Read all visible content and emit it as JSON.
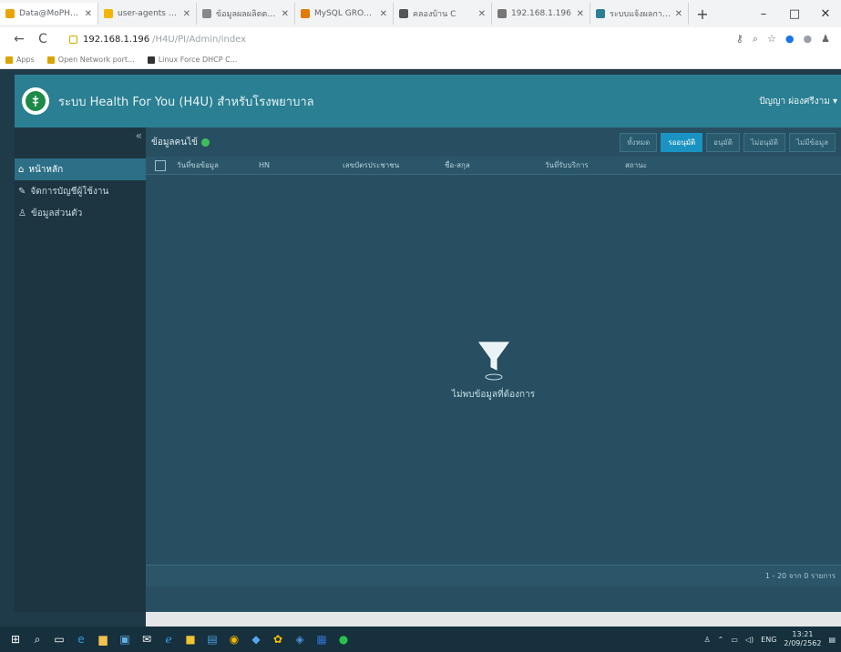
{
  "browser": {
    "tabs": [
      {
        "title": "Data@MoPH Front",
        "color": "#e8a400"
      },
      {
        "title": "user-agents - nom",
        "color": "#f2b600"
      },
      {
        "title": "ข้อมูลผลผลิตตกปลา",
        "color": "#888888"
      },
      {
        "title": "MySQL GROUP_CO",
        "color": "#e07b00"
      },
      {
        "title": "คลองบ้าน C",
        "color": "#555555"
      },
      {
        "title": "192.168.1.196",
        "color": "#777777"
      },
      {
        "title": "ระบบแจ้งผลการเรียน",
        "color": "#2a7f92"
      }
    ],
    "new_tab": "+",
    "window_controls": {
      "minimize": "–",
      "maximize": "□",
      "close": "✕"
    },
    "nav": {
      "back": "←",
      "reload": "C"
    },
    "url_host": "192.168.1.196",
    "url_path": "/H4U/PI/Admin/index",
    "bookmarks": [
      {
        "label": "Apps"
      },
      {
        "label": "Open Network port..."
      },
      {
        "label": "Linux Force DHCP C..."
      }
    ]
  },
  "header": {
    "logo": "H4U",
    "title": "ระบบ Health For You (H4U) สำหรับโรงพยาบาล",
    "user": "ปัญญา ผ่องศรีงาม ▾"
  },
  "sidebar": {
    "collapse": "«",
    "items": [
      {
        "label": "หน้าหลัก",
        "icon": "home-icon",
        "glyph": "⌂"
      },
      {
        "label": "จัดการบัญชีผู้ใช้งาน",
        "icon": "edit-icon",
        "glyph": "✎"
      },
      {
        "label": "ข้อมูลส่วนตัว",
        "icon": "user-icon",
        "glyph": "♙"
      }
    ]
  },
  "main": {
    "title": "ข้อมูลคนไข้",
    "filters": [
      "ทั้งหมด",
      "รออนุมัติ",
      "อนุมัติ",
      "ไม่อนุมัติ",
      "ไม่มีข้อมูล"
    ],
    "active_filter": "รออนุมัติ",
    "columns": [
      "วันที่ขอข้อมูล",
      "HN",
      "เลขบัตรประชาชน",
      "ชื่อ-สกุล",
      "วันที่รับบริการ",
      "สถานะ"
    ],
    "empty_text": "ไม่พบข้อมูลที่ต้องการ",
    "footer": "1 - 20 จาก 0 รายการ"
  },
  "taskbar": {
    "tray": {
      "lang": "ENG",
      "time": "13:21",
      "date": "2/09/2562"
    }
  }
}
